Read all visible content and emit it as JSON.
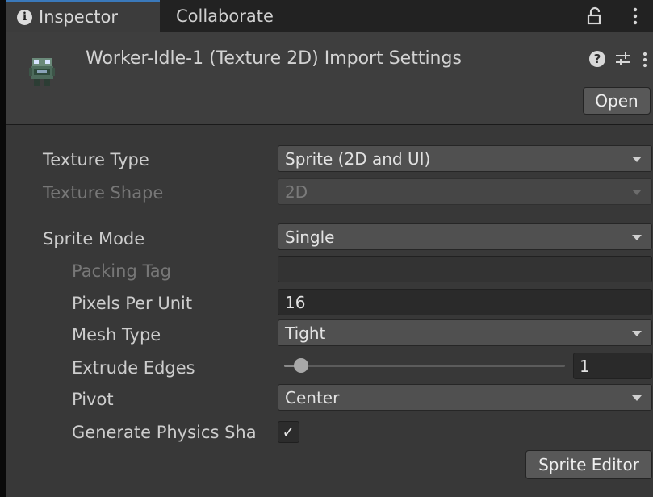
{
  "tabs": {
    "inspector_label": "Inspector",
    "collaborate_label": "Collaborate",
    "info_glyph": "i"
  },
  "header": {
    "title": "Worker-Idle-1 (Texture 2D) Import Settings",
    "help_glyph": "?",
    "open_label": "Open"
  },
  "settings": {
    "texture_type": {
      "label": "Texture Type",
      "value": "Sprite (2D and UI)"
    },
    "texture_shape": {
      "label": "Texture Shape",
      "value": "2D"
    },
    "sprite_mode": {
      "label": "Sprite Mode",
      "value": "Single"
    },
    "packing_tag": {
      "label": "Packing Tag",
      "value": ""
    },
    "pixels_per_unit": {
      "label": "Pixels Per Unit",
      "value": "16"
    },
    "mesh_type": {
      "label": "Mesh Type",
      "value": "Tight"
    },
    "extrude_edges": {
      "label": "Extrude Edges",
      "value": "1",
      "slider_fraction": 0.06
    },
    "pivot": {
      "label": "Pivot",
      "value": "Center"
    },
    "generate_physics_shape": {
      "label": "Generate Physics Sha",
      "checked": true,
      "check_glyph": "✓"
    }
  },
  "buttons": {
    "sprite_editor_label": "Sprite Editor"
  },
  "colors": {
    "panel_bg": "#383838",
    "tab_accent": "#3a79bb",
    "field_bg": "#2a2a2a",
    "dropdown_bg": "#505050"
  },
  "icons": {
    "info": "info-icon",
    "lock": "lock-icon",
    "menu": "kebab-menu-icon",
    "help": "help-icon",
    "presets": "preset-sliders-icon",
    "thumbnail": "sprite-thumbnail-icon"
  }
}
